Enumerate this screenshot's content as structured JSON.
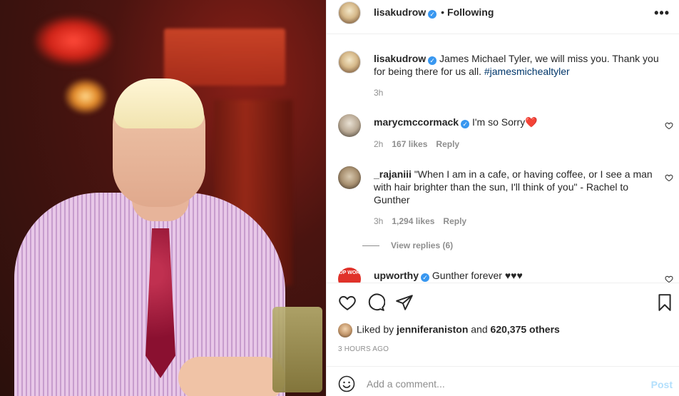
{
  "post": {
    "author": "lisakudrow",
    "follow_status": "Following",
    "more_label": "•••",
    "caption_text": "James Michael Tyler, we will miss you. Thank you for being there for us all.",
    "caption_hashtag": "#jamesmichealtyler",
    "caption_time": "3h"
  },
  "comments": [
    {
      "user": "marycmccormack",
      "verified": true,
      "text": "I'm so Sorry❤️",
      "time": "2h",
      "likes": "167 likes",
      "reply": "Reply"
    },
    {
      "user": "_rajaniii",
      "verified": false,
      "text": "\"When I am in a cafe, or having coffee, or I see a man with hair brighter than the sun, I'll think of you\" - Rachel to Gunther",
      "time": "3h",
      "likes": "1,294 likes",
      "reply": "Reply",
      "view_replies": "View replies (6)"
    },
    {
      "user": "upworthy",
      "verified": true,
      "text": "Gunther forever ♥♥♥",
      "avatar_text": "UP WOR"
    }
  ],
  "likes": {
    "prefix": "Liked by",
    "user": "jenniferaniston",
    "middle": "and",
    "count": "620,375 others"
  },
  "timestamp": "3 HOURS AGO",
  "add_comment": {
    "placeholder": "Add a comment...",
    "post_label": "Post"
  },
  "colors": {
    "verified": "#3897f0",
    "post_button": "#b2dffc",
    "hashtag": "#00376b"
  }
}
